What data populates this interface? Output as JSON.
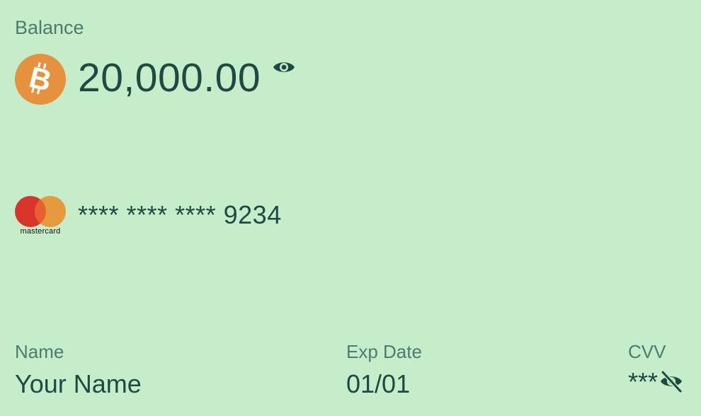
{
  "balance": {
    "label": "Balance",
    "amount": "20,000.00",
    "currency_icon": "bitcoin-icon",
    "visibility_icon": "eye-icon"
  },
  "card": {
    "brand": "mastercard",
    "masked_number": "**** **** **** 9234"
  },
  "fields": {
    "name_label": "Name",
    "name_value": "Your Name",
    "exp_label": "Exp Date",
    "exp_value": "01/01",
    "cvv_label": "CVV",
    "cvv_value": "***",
    "cvv_visibility_icon": "eye-off-icon"
  },
  "colors": {
    "background": "#c6edc9",
    "text_primary": "#1f4a44",
    "text_secondary": "#4d7b72",
    "bitcoin": "#e6913d",
    "mastercard_red": "#d8342c",
    "mastercard_orange": "#e6993d"
  }
}
